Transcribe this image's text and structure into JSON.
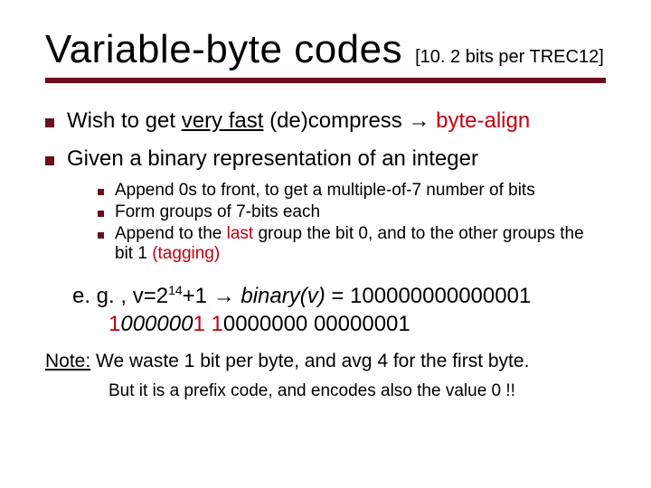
{
  "title": "Variable-byte codes",
  "title_annotation": "[10. 2 bits per TREC12]",
  "bullets": {
    "b1_pre": "Wish to get ",
    "b1_u": "very fast",
    "b1_mid": " (de)compress ",
    "b1_arrow": "→",
    "b1_red": " byte-align",
    "b2": "Given a binary representation of an integer"
  },
  "subbullets": {
    "s1": "Append 0s to front, to get a multiple-of-7 number of bits",
    "s2": "Form groups of 7-bits each",
    "s3_pre": "Append to the ",
    "s3_last": "last",
    "s3_mid": " group the bit 0, and to the other groups the bit 1 ",
    "s3_tag": "(tagging)"
  },
  "example": {
    "lead": "e. g. , v=2",
    "exp": "14",
    "plus": "+1 ",
    "arrow": "→",
    "bin_label": " binary(v)",
    "eq": " =  100000000000001",
    "grp1_lead1": "1",
    "grp1_mid": "000000",
    "grp1_trail1": "1",
    "sp1": "  ",
    "grp2_lead1": "1",
    "grp2_rest": "0000000",
    "sp2": "  ",
    "grp3": "00000001"
  },
  "note": {
    "label": "Note:",
    "rest": " We waste 1 bit per byte, and avg 4 for the first byte."
  },
  "note2": "But it is a prefix code, and encodes also the value 0 !!"
}
